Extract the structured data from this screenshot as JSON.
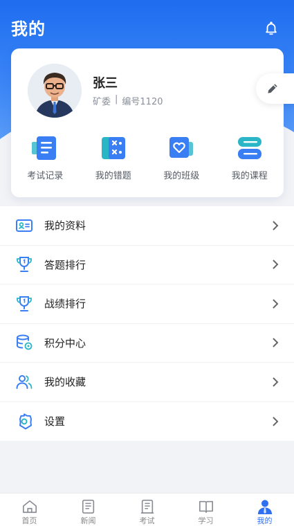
{
  "header": {
    "title": "我的"
  },
  "profile": {
    "name": "张三",
    "role": "矿委",
    "separator": "|",
    "id_text": "编号1120"
  },
  "quick_links": [
    {
      "label": "考试记录",
      "icon": "exam-record-icon"
    },
    {
      "label": "我的错题",
      "icon": "wrong-questions-icon"
    },
    {
      "label": "我的班级",
      "icon": "class-icon"
    },
    {
      "label": "我的课程",
      "icon": "course-icon"
    }
  ],
  "menu": [
    {
      "label": "我的资料",
      "icon": "id-card-icon"
    },
    {
      "label": "答题排行",
      "icon": "trophy-icon"
    },
    {
      "label": "战绩排行",
      "icon": "trophy-icon"
    },
    {
      "label": "积分中心",
      "icon": "database-icon"
    },
    {
      "label": "我的收藏",
      "icon": "users-icon"
    },
    {
      "label": "设置",
      "icon": "settings-icon"
    }
  ],
  "tabs": [
    {
      "label": "首页",
      "icon": "home-icon"
    },
    {
      "label": "新闻",
      "icon": "news-icon"
    },
    {
      "label": "考试",
      "icon": "exam-icon"
    },
    {
      "label": "学习",
      "icon": "book-icon"
    },
    {
      "label": "我的",
      "icon": "person-icon",
      "active": true
    }
  ],
  "colors": {
    "accent": "#2f6ff0",
    "header": "#1f6df0",
    "icon_blue": "#3a7ef3",
    "icon_teal": "#2bb6c8"
  }
}
